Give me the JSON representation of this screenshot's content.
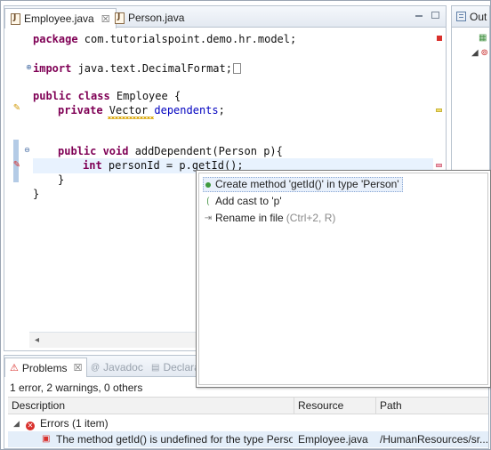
{
  "editor": {
    "tabs": [
      {
        "label": "Employee.java",
        "close": "☒",
        "active": true
      },
      {
        "label": "Person.java",
        "active": false
      }
    ],
    "code_lines": {
      "package_kw": "package",
      "package_rest": " com.tutorialspoint.demo.hr.model;",
      "import_kw": "import",
      "import_rest": " java.text.DecimalFormat;",
      "class_kw": "public class",
      "class_rest": " Employee {",
      "field_kw": "private",
      "field_type": " Vector ",
      "field_name": "dependents",
      "field_end": ";",
      "method_kw": "public void",
      "method_rest": " addDependent(Person p){",
      "local_kw": "int",
      "local_rest": " personId = p.getId();",
      "close_inner": "}",
      "close_outer": "}"
    }
  },
  "outline": {
    "tab_label": "Out"
  },
  "quick_fix": {
    "items": [
      {
        "label": "Create method 'getId()' in type 'Person'",
        "icon": "green-dot-icon",
        "selected": true
      },
      {
        "label": "Add cast to 'p'",
        "icon": "cast-icon",
        "selected": false
      },
      {
        "label": "Rename in file",
        "shortcut": "(Ctrl+2, R)",
        "icon": "rename-icon",
        "selected": false
      }
    ]
  },
  "problems": {
    "tabs": [
      {
        "label": "Problems",
        "close": "☒",
        "active": true
      },
      {
        "label": "Javadoc",
        "active": false
      },
      {
        "label": "Declarat",
        "active": false
      }
    ],
    "summary": "1 error, 2 warnings, 0 others",
    "columns": [
      "Description",
      "Resource",
      "Path"
    ],
    "group_label": "Errors (1 item)",
    "error_row": {
      "description": "The method getId() is undefined for the type Person",
      "resource": "Employee.java",
      "path": "/HumanResources/sr..."
    }
  },
  "colors": {
    "keyword": "#7f0055",
    "field": "#0000c0",
    "error": "#d9302c",
    "current_line": "#e8f2fe"
  }
}
